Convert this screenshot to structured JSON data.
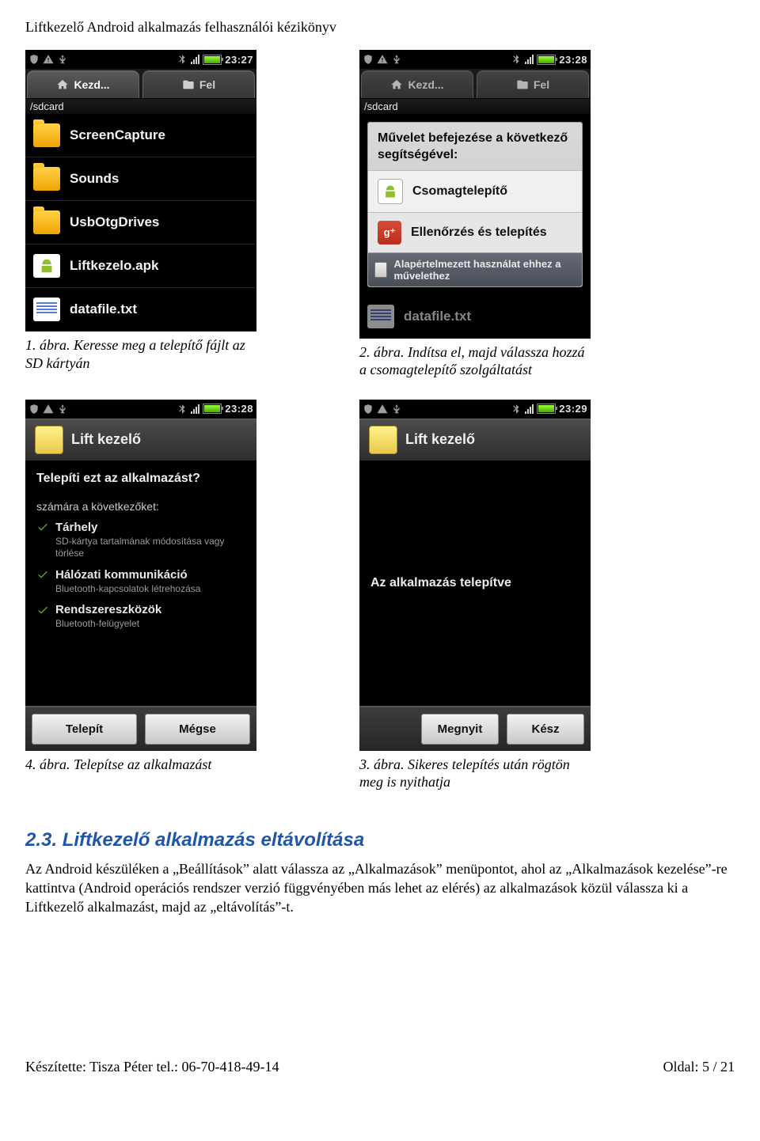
{
  "header": "Liftkezelő Android alkalmazás felhasználói kézikönyv",
  "screens": {
    "s1": {
      "time": "23:27",
      "tabs": {
        "home": "Kezd...",
        "up": "Fel"
      },
      "path": "/sdcard",
      "files": [
        {
          "name": "ScreenCapture",
          "type": "folder"
        },
        {
          "name": "Sounds",
          "type": "folder"
        },
        {
          "name": "UsbOtgDrives",
          "type": "folder"
        },
        {
          "name": "Liftkezelo.apk",
          "type": "apk"
        },
        {
          "name": "datafile.txt",
          "type": "txt"
        }
      ]
    },
    "s2": {
      "time": "23:28",
      "tabs": {
        "home": "Kezd...",
        "up": "Fel"
      },
      "path": "/sdcard",
      "dialog": {
        "title": "Művelet befejezése a következő segítségével:",
        "opt1": "Csomagtelepítő",
        "opt2": "Ellenőrzés és telepítés",
        "foot": "Alapértelmezett használat ehhez a művelethez"
      },
      "dimfile": "datafile.txt"
    },
    "s3": {
      "time": "23:28",
      "title": "Lift kezelő",
      "q": "Telepíti ezt az alkalmazást?",
      "sub": "számára a következőket:",
      "perms": [
        {
          "name": "Tárhely",
          "desc": "SD-kártya tartalmának módosítása vagy törlése"
        },
        {
          "name": "Hálózati kommunikáció",
          "desc": "Bluetooth-kapcsolatok létrehozása"
        },
        {
          "name": "Rendszereszközök",
          "desc": "Bluetooth-felügyelet"
        }
      ],
      "btn1": "Telepít",
      "btn2": "Mégse"
    },
    "s4": {
      "time": "23:29",
      "title": "Lift kezelő",
      "msg": "Az alkalmazás telepítve",
      "btn1": "Megnyit",
      "btn2": "Kész"
    }
  },
  "captions": {
    "c1": "1. ábra. Keresse meg a telepítő fájlt az SD kártyán",
    "c2": "2. ábra. Indítsa el, majd válassza hozzá a csomagtelepítő szolgáltatást",
    "c3": "4. ábra. Telepítse az alkalmazást",
    "c4": "3. ábra. Sikeres telepítés után rögtön meg is nyithatja"
  },
  "section": {
    "num": "2.3.",
    "title": "Liftkezelő alkalmazás eltávolítása",
    "body": "Az Android készüléken a „Beállítások” alatt válassza az „Alkalmazások” menüpontot, ahol az „Alkalmazások kezelése”-re kattintva (Android operációs rendszer verzió függvényében más lehet az elérés) az alkalmazások közül válassza ki a Liftkezelő alkalmazást, majd az „eltávolítás”-t."
  },
  "footer": {
    "left": "Készítette: Tisza Péter tel.: 06-70-418-49-14",
    "right": "Oldal: 5 / 21"
  }
}
